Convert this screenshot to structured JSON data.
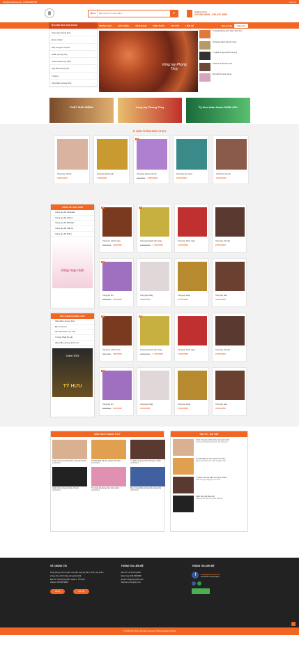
{
  "topbar": {
    "left": "info@phongthuy.com  |  0369.888.999",
    "right": "f  G+  t  in"
  },
  "header": {
    "search_category": "Tất cả",
    "search_placeholder": "Bạn muốn tìm sản phẩm...",
    "hotline_label": "Hotline hỗ trợ",
    "hotline_numbers": "039.985.9998 - 036.457.8886"
  },
  "nav": {
    "category_title": "DANH MỤC SẢN PHẨM",
    "items": [
      "TRANG CHỦ",
      "GIỚI THIỆU",
      "SẢN PHẨM",
      "KIẾN THỨC",
      "TIN TỨC",
      "LIÊN HỆ"
    ],
    "login": "Đăng nhập",
    "register": "Đăng ký"
  },
  "categories": [
    "Vòng tay phong thủy",
    "Đá tự nhiên",
    "Dây chuyền mặt đá",
    "Nhẫn phong thủy",
    "Tranh đá phong thủy",
    "Cây đá phong thủy",
    "Tỳ Hưu",
    "Vật phẩm phong thủy"
  ],
  "slider": {
    "caption": "Vòng tay Phong Thủy"
  },
  "side_news": [
    "5 loại đá phong thủy hợp mệnh Kim",
    "Vòng tay thạch anh tóc vàng",
    "Ý nghĩa vòng tay trầm hương",
    "Cách chọn đá theo tuổi",
    "Đá mắt hổ và tác dụng"
  ],
  "banners": [
    {
      "text": "PHẬT BẢN MỆNH"
    },
    {
      "text": "Vòng tay Phong Thủy"
    },
    {
      "text": "Tỳ Hưu thần thánh GIẢM 40%"
    }
  ],
  "hot": {
    "title": "SẢN PHẨM BÁN CHẠY",
    "products": [
      {
        "name": "Vòng tay mắt hổ",
        "price": "2.600.000₫",
        "old": ""
      },
      {
        "name": "Vòng tay thạch anh",
        "price": "2.500.000₫",
        "old": ""
      },
      {
        "name": "Vòng tay thạch anh tím",
        "price": "2.500.000₫",
        "old": "300.000₫"
      },
      {
        "name": "Vòng tay lam ngọc",
        "price": "2.500.000₫",
        "old": ""
      },
      {
        "name": "Vòng tay mã não",
        "price": "2.500.000₫",
        "old": ""
      }
    ]
  },
  "block1": {
    "title": "VÒNG TAY MAY MẮN",
    "list": [
      "Vòng tay đá Obsidian",
      "Vòng tay đá Citrine",
      "Vòng tay đá Mã Não",
      "Vòng tay đá mắt hổ",
      "Vòng tay đá Ruby"
    ],
    "banner_text": "Vòng may mắn",
    "products": [
      {
        "name": "Vòng tay mắt hổ nâu",
        "price": "399.000₫",
        "old": "450.000₫"
      },
      {
        "name": "Vòng tay thạch anh vàng",
        "price": "1.450.000₫",
        "old": "2.600.000₫"
      },
      {
        "name": "Vòng tay hồng ngọc",
        "price": "2.500.000₫",
        "old": ""
      },
      {
        "name": "Vòng tay mã não",
        "price": "2.500.000₫",
        "old": ""
      },
      {
        "name": "Vòng tay tím",
        "price": "300.000₫",
        "old": "350.000₫"
      },
      {
        "name": "Vòng tay trắng",
        "price": "2.500.000₫",
        "old": ""
      },
      {
        "name": "Vòng tay vàng",
        "price": "2.500.000₫",
        "old": ""
      },
      {
        "name": "Vòng tay nâu",
        "price": "3.400.000₫",
        "old": ""
      }
    ]
  },
  "block2": {
    "title": "VẬT PHẨM PHONG THỦY",
    "list": [
      "Vật phẩm phong thủy",
      "Bộ mười hai",
      "Tam đa Phúc Lộc Thọ",
      "Tượng Phật Di Lặc",
      "Vật phẩm phong thủy Cóc"
    ],
    "banner_text": "TỲ HƯU",
    "banner_sub": "Giảm 30%",
    "products": [
      {
        "name": "Vòng tay mắt hổ nâu",
        "price": "399.000₫",
        "old": "450.000₫"
      },
      {
        "name": "Vòng tay thạch anh vàng",
        "price": "1.450.000₫",
        "old": "2.600.000₫"
      },
      {
        "name": "Vòng tay hồng ngọc",
        "price": "2.500.000₫",
        "old": ""
      },
      {
        "name": "Vòng tay mã não",
        "price": "2.500.000₫",
        "old": ""
      },
      {
        "name": "Vòng tay tím",
        "price": "300.000₫",
        "old": "350.000₫"
      },
      {
        "name": "Vòng tay trắng",
        "price": "2.500.000₫",
        "old": ""
      },
      {
        "name": "Vòng tay vàng",
        "price": "2.500.000₫",
        "old": ""
      },
      {
        "name": "Vòng tay nâu",
        "price": "3.400.000₫",
        "old": ""
      }
    ]
  },
  "knowledge": {
    "title": "KIẾN THỨC PHONG THỦY",
    "articles": [
      {
        "title": "5 loại vòng tay phong thủy mang lại tài lộc",
        "date": "20/05/2019"
      },
      {
        "title": "Vị Thần Bảo Hộ cho người tuổi Thân",
        "date": "20/05/2019"
      },
      {
        "title": "Ý nghĩa vòng tay trầm hương tự nhiên",
        "date": "20/05/2019"
      },
      {
        "title": "Cách chọn vòng tay hợp với tuổi",
        "date": "20/05/2019"
      },
      {
        "title": "Tìm hiểu đá phong thủy hợp mệnh",
        "date": "20/05/2019"
      },
      {
        "title": "Bày trí vật phẩm phong thủy trong nhà",
        "date": "20/05/2019"
      }
    ]
  },
  "news": {
    "title": "TIN TỨC - BÀI VIẾT",
    "items": [
      {
        "title": "5 loại vòng tay phong thủy mang lại tài lộc",
        "desc": "Vòng tay phong thủy giúp thu hút may mắn"
      },
      {
        "title": "Vị Thần Bảo Hộ cho người tuổi Thân",
        "desc": "Người tuổi Thân nên chọn vật phẩm nào"
      },
      {
        "title": "Ý nghĩa vòng tay trầm hương tự nhiên",
        "desc": "Trầm hương mang lại sự bình an"
      },
      {
        "title": "Cách chọn đá theo tuổi",
        "desc": "Chọn đá phù hợp với mệnh của bạn"
      }
    ]
  },
  "footer": {
    "about_title": "VỀ CHÚNG TÔI",
    "about_text": "Shop phong thủy chuyên cung cấp vòng tay đá tự nhiên, vật phẩm phong thủy chính hãng với giá tốt nhất.",
    "address": "Địa chỉ: 123 Đường ABC, Quận 1, TP.HCM",
    "phone": "Hotline: 039.985.9998",
    "btn1": "Hỗ trợ",
    "btn2": "Liên hệ",
    "contact_title": "THÔNG TIN LIÊN HỆ",
    "contact_lines": [
      "Địa chỉ: 123 Đường ABC",
      "Điện thoại: 039.985.9998",
      "Email: info@phongthuy.com",
      "Website: phongthuy.com"
    ],
    "social_title": "THÔNG TIN LIÊN HỆ",
    "fanpage": "Fanpage Facebook",
    "fanpage_url": "facebook.com/phongthuy"
  },
  "bottom": "© 2019 Phong Thủy. All rights reserved. Thiết kế website bởi Web"
}
